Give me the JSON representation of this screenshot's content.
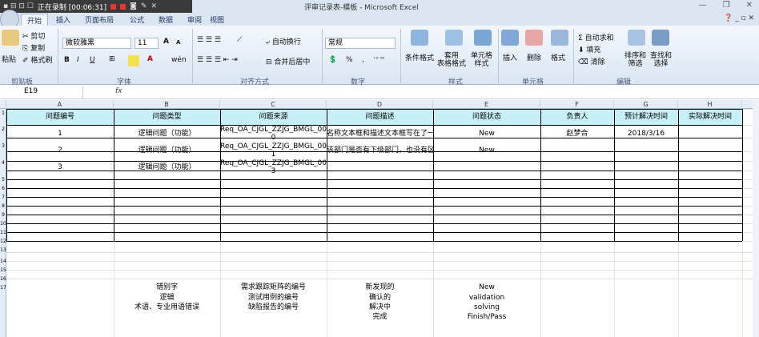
{
  "window": {
    "title": "评审记录表-模板 - Microsoft Excel",
    "recording_label": "正在录制 [00:06:31]",
    "buttons": [
      "—",
      "❐",
      "✕"
    ]
  },
  "ribbon_tabs": [
    "开始",
    "插入",
    "页面布局",
    "公式",
    "数据",
    "审阅",
    "视图"
  ],
  "ribbon": {
    "clipboard": {
      "paste": "粘贴",
      "cut": "剪切",
      "copy": "复制",
      "format_painter": "格式刷",
      "group": "剪贴板"
    },
    "font": {
      "name": "微软雅黑",
      "size": "11",
      "bold": "B",
      "italic": "I",
      "underline": "U",
      "group": "字体",
      "grow": "A",
      "shrink": "A",
      "font_color": "A",
      "phonetic": "wén"
    },
    "alignment": {
      "wrap": "自动换行",
      "merge": "合并后居中",
      "group": "对齐方式"
    },
    "number": {
      "format": "常规",
      "percent": "%",
      "comma": ",",
      "group": "数字"
    },
    "styles": {
      "conditional": "条件格式",
      "table": "套用\n表格格式",
      "cell": "单元格\n样式",
      "group": "样式"
    },
    "cells": {
      "insert": "插入",
      "delete": "删除",
      "format": "格式",
      "group": "单元格"
    },
    "editing": {
      "autosum": "自动求和",
      "fill": "填充",
      "clear": "清除",
      "sort": "排序和\n筛选",
      "find": "查找和\n选择",
      "group": "编辑"
    }
  },
  "formula_bar": {
    "name_box": "E19",
    "fx": "fx",
    "value": ""
  },
  "columns": [
    "A",
    "B",
    "C",
    "D",
    "E",
    "F",
    "G",
    "H"
  ],
  "row_numbers": [
    "1",
    "2",
    "3",
    "4",
    "5",
    "6",
    "7",
    "8",
    "9",
    "10",
    "11",
    "12",
    "13",
    "14",
    "15",
    "16",
    "17"
  ],
  "header_row": [
    "问题编号",
    "问题类型",
    "问题来源",
    "问题描述",
    "问题状态",
    "负责人",
    "预计解决时间",
    "实际解决时间"
  ],
  "data_rows": [
    [
      "1",
      "逻辑问题（功能）",
      "Req_OA_CJGL_ZZJG_BMGL_002\n0",
      "名称文本框和描述文本框写在了一起",
      "New",
      "赵梦合",
      "2018/3/16",
      ""
    ],
    [
      "2",
      "逻辑问题（功能）",
      "Req_OA_CJGL_ZZJG_BMGL_002\n1",
      "该部门是否有下级部门，也没有区分出",
      "New",
      "",
      "",
      ""
    ],
    [
      "3",
      "逻辑问题（功能）",
      "Req_OA_CJGL_ZZJG_BMGL_002\n3",
      "",
      "",
      "",
      "",
      ""
    ]
  ],
  "legend_rows": [
    [
      "",
      "错别字",
      "需求跟踪矩阵的编号",
      "新发现的",
      "New"
    ],
    [
      "",
      "逻辑",
      "测试用例的编号",
      "确认的",
      "validation"
    ],
    [
      "",
      "术语、专业用语错误",
      "缺陷报告的编号",
      "解决中",
      "solving"
    ],
    [
      "",
      "",
      "",
      "完成",
      "Finish/Pass"
    ]
  ],
  "colors": {
    "header_fill": "#c6f0f7",
    "ribbon_bg": "#dbe5f1"
  }
}
